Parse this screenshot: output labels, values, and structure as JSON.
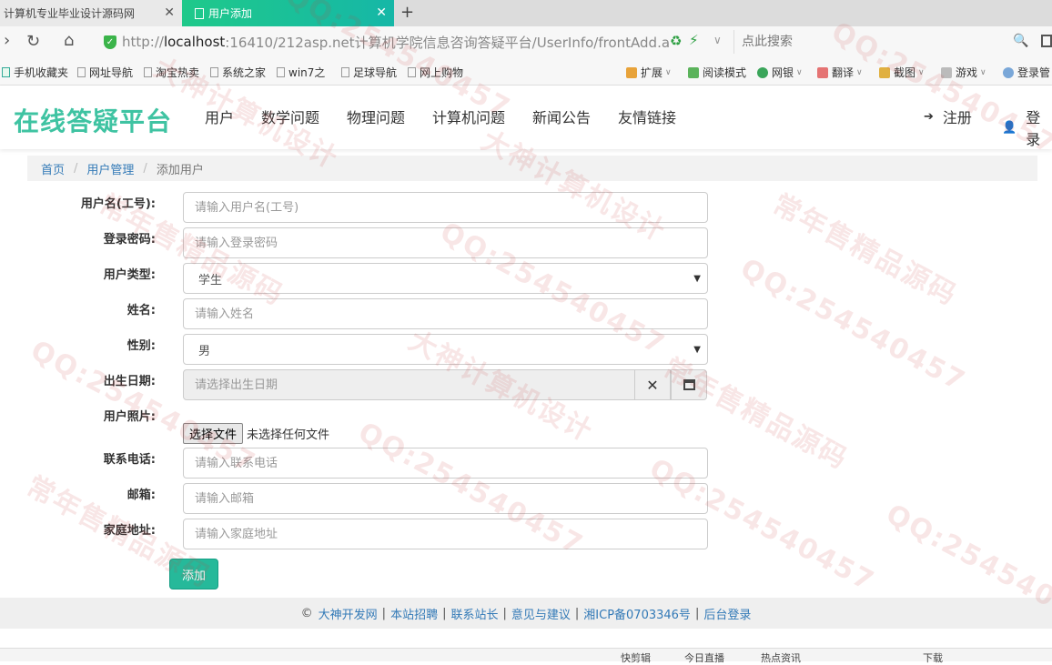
{
  "browser": {
    "tabs": [
      {
        "label": "计算机专业毕业设计源码网",
        "active": false
      },
      {
        "label": "用户添加",
        "active": true
      }
    ],
    "url": {
      "scheme": "http://",
      "host": "localhost",
      "rest": ":16410/212asp.net计算机学院信息咨询答疑平台/UserInfo/frontAdd.a"
    },
    "search_placeholder": "点此搜索",
    "bookmarks": [
      "手机收藏夹",
      "网址导航",
      "淘宝热卖",
      "系统之家",
      "win7之",
      "足球导航",
      "网上购物"
    ],
    "extensions": [
      "扩展",
      "阅读模式",
      "网银",
      "翻译",
      "截图",
      "游戏",
      "登录管"
    ]
  },
  "site": {
    "brand": "在线答疑平台",
    "nav": [
      "用户",
      "数学问题",
      "物理问题",
      "计算机问题",
      "新闻公告",
      "友情链接"
    ],
    "register": "注册",
    "login": "登录"
  },
  "breadcrumb": {
    "home": "首页",
    "section": "用户管理",
    "current": "添加用户"
  },
  "form": {
    "username": {
      "label": "用户名(工号):",
      "placeholder": "请输入用户名(工号)"
    },
    "password": {
      "label": "登录密码:",
      "placeholder": "请输入登录密码"
    },
    "user_type": {
      "label": "用户类型:",
      "value": "学生"
    },
    "name": {
      "label": "姓名:",
      "placeholder": "请输入姓名"
    },
    "gender": {
      "label": "性别:",
      "value": "男"
    },
    "birthday": {
      "label": "出生日期:",
      "placeholder": "请选择出生日期"
    },
    "photo": {
      "label": "用户照片:",
      "button": "选择文件",
      "note": "未选择任何文件"
    },
    "phone": {
      "label": "联系电话:",
      "placeholder": "请输入联系电话"
    },
    "email": {
      "label": "邮箱:",
      "placeholder": "请输入邮箱"
    },
    "address": {
      "label": "家庭地址:",
      "placeholder": "请输入家庭地址"
    },
    "submit": "添加"
  },
  "footer": {
    "copyright": "©",
    "links": [
      "大神开发网",
      "本站招聘",
      "联系站长",
      "意见与建议",
      "湘ICP备0703346号",
      "后台登录"
    ]
  },
  "statusbar": [
    "快剪辑",
    "今日直播",
    "热点资讯",
    "下载"
  ],
  "watermarks": [
    "QQ:254540457",
    "常年售精品源码",
    "大神计算机设计"
  ],
  "colors": {
    "brand": "#3fc3a2",
    "tab_active": "#1fc98a",
    "submit": "#26b99a",
    "link": "#337ab7"
  }
}
